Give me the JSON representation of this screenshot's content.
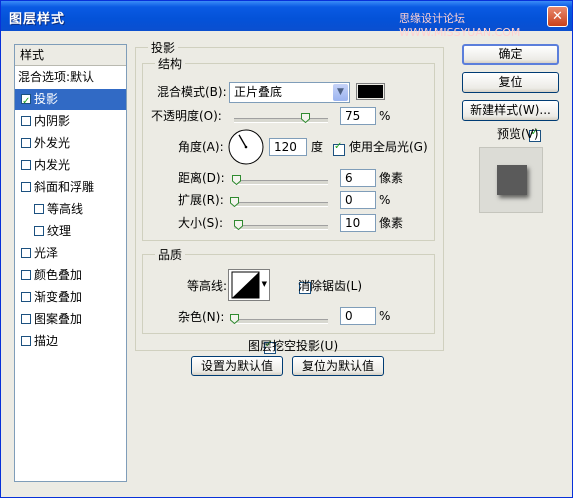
{
  "window": {
    "title": "图层样式",
    "watermark": "思缘设计论坛 WWW.MISSYUAN.COM",
    "close_glyph": "✕"
  },
  "sidebar": {
    "header": "样式",
    "blend_item": "混合选项:默认",
    "items": [
      {
        "label": "投影",
        "checked": true,
        "selected": true,
        "indent": false
      },
      {
        "label": "内阴影",
        "checked": false,
        "selected": false,
        "indent": false
      },
      {
        "label": "外发光",
        "checked": false,
        "selected": false,
        "indent": false
      },
      {
        "label": "内发光",
        "checked": false,
        "selected": false,
        "indent": false
      },
      {
        "label": "斜面和浮雕",
        "checked": false,
        "selected": false,
        "indent": false
      },
      {
        "label": "等高线",
        "checked": false,
        "selected": false,
        "indent": true
      },
      {
        "label": "纹理",
        "checked": false,
        "selected": false,
        "indent": true
      },
      {
        "label": "光泽",
        "checked": false,
        "selected": false,
        "indent": false
      },
      {
        "label": "颜色叠加",
        "checked": false,
        "selected": false,
        "indent": false
      },
      {
        "label": "渐变叠加",
        "checked": false,
        "selected": false,
        "indent": false
      },
      {
        "label": "图案叠加",
        "checked": false,
        "selected": false,
        "indent": false
      },
      {
        "label": "描边",
        "checked": false,
        "selected": false,
        "indent": false
      }
    ]
  },
  "panel": {
    "title": "投影",
    "structure": {
      "title": "结构",
      "blend_mode_label": "混合模式(B):",
      "blend_mode_value": "正片叠底",
      "shadow_color": "#000000",
      "opacity_label": "不透明度(O):",
      "opacity_value": "75",
      "opacity_fraction": 0.75,
      "percent": "%",
      "angle_label": "角度(A):",
      "angle_value": "120",
      "angle_unit": "度",
      "global_light_label": "使用全局光(G)",
      "global_light_checked": true,
      "distance_label": "距离(D):",
      "distance_value": "6",
      "distance_fraction": 0.02,
      "pixel_unit": "像素",
      "spread_label": "扩展(R):",
      "spread_value": "0",
      "spread_fraction": 0.0,
      "size_label": "大小(S):",
      "size_value": "10",
      "size_fraction": 0.04
    },
    "quality": {
      "title": "品质",
      "contour_label": "等高线:",
      "antialias_label": "消除锯齿(L)",
      "antialias_checked": false,
      "noise_label": "杂色(N):",
      "noise_value": "0",
      "noise_fraction": 0.0
    },
    "knockout_label": "图层挖空投影(U)",
    "knockout_checked": true,
    "set_default_label": "设置为默认值",
    "reset_default_label": "复位为默认值"
  },
  "buttons": {
    "ok": "确定",
    "reset": "复位",
    "new_style": "新建样式(W)...",
    "preview_label": "预览(V)",
    "preview_checked": true
  }
}
